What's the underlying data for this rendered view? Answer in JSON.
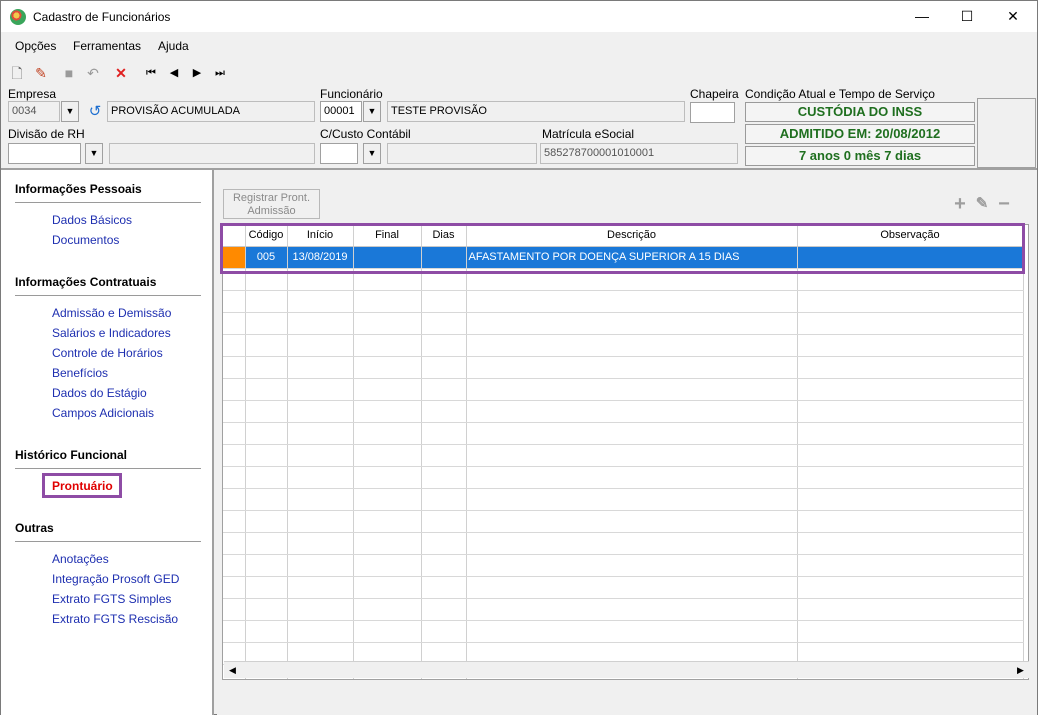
{
  "window": {
    "title": "Cadastro de Funcionários",
    "minimize": "—",
    "maximize": "☐",
    "close": "✕"
  },
  "menu": {
    "items": [
      "Opções",
      "Ferramentas",
      "Ajuda"
    ]
  },
  "toolbar": {
    "icons": [
      "new-document-icon",
      "edit-icon",
      "save-icon",
      "undo-icon",
      "delete-icon",
      "first-record-icon",
      "previous-record-icon",
      "next-record-icon",
      "last-record-icon"
    ],
    "glyphs": {
      "new": "🗋",
      "edit": "✎",
      "save": "■",
      "undo": "↶",
      "delete": "✕",
      "first": "⏮",
      "prev": "◀",
      "next": "▶",
      "last": "⏭"
    }
  },
  "form": {
    "empresa_label": "Empresa",
    "empresa_code": "0034",
    "empresa_name": "PROVISÃO ACUMULADA",
    "funcionario_label": "Funcionário",
    "funcionario_code": "00001",
    "funcionario_name": "TESTE PROVISÃO",
    "chapeira_label": "Chapeira",
    "chapeira_value": "",
    "condicao_label": "Condição Atual e Tempo de Serviço",
    "status_1": "CUSTÓDIA DO INSS",
    "status_2": "ADMITIDO EM: 20/08/2012",
    "status_3": "7 anos 0 mês 7 dias",
    "divisao_label": "Divisão de RH",
    "divisao_value": "",
    "ccusto_label": "C/Custo Contábil",
    "ccusto_value": "",
    "matricula_label": "Matrícula eSocial",
    "matricula_value": "585278700001010001"
  },
  "sidebar": {
    "sections": [
      {
        "title": "Informações Pessoais",
        "items": [
          "Dados Básicos",
          "Documentos"
        ]
      },
      {
        "title": "Informações Contratuais",
        "items": [
          "Admissão e Demissão",
          "Salários e Indicadores",
          "Controle de Horários",
          "Benefícios",
          "Dados do Estágio",
          "Campos Adicionais"
        ]
      },
      {
        "title": "Histórico Funcional",
        "items": [
          "Prontuário"
        ]
      },
      {
        "title": "Outras",
        "items": [
          "Anotações",
          "Integração Prosoft GED",
          "Extrato FGTS Simples",
          "Extrato FGTS Rescisão"
        ]
      }
    ],
    "active_item": "Prontuário"
  },
  "main": {
    "register_button": "Registrar Pront. Admissão",
    "add_glyph": "+",
    "edit_glyph": "✎",
    "remove_glyph": "−",
    "columns": [
      "Código",
      "Início",
      "Final",
      "Dias",
      "Descrição",
      "Observação"
    ],
    "rows": [
      {
        "codigo": "005",
        "inicio": "13/08/2019",
        "final": "",
        "dias": "",
        "descricao": "AFASTAMENTO POR DOENÇA SUPERIOR A 15 DIAS",
        "observacao": ""
      }
    ],
    "scroll_left": "◀",
    "scroll_right": "▶"
  },
  "colors": {
    "highlight_border": "#8e4ca5",
    "selected_row": "#1a78d8",
    "row_indicator": "#ff8a00",
    "link": "#1e2fb0",
    "active_link": "#e00000",
    "status_text": "#1f6f1f"
  }
}
